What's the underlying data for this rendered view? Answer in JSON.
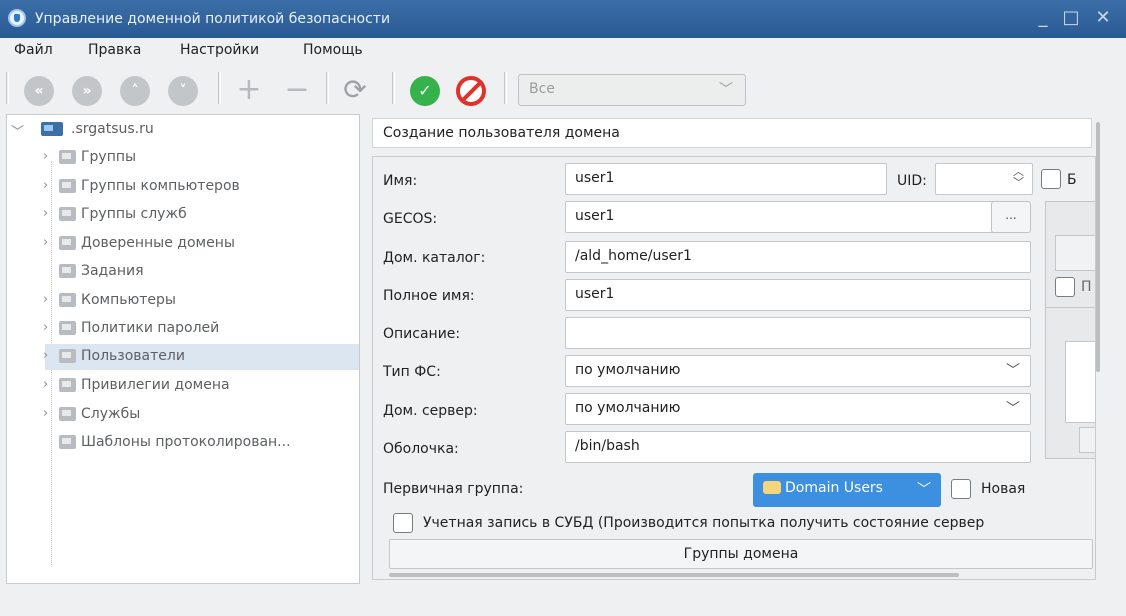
{
  "window": {
    "title": "Управление доменной политикой безопасности",
    "controls": [
      "_",
      "□",
      "✕"
    ]
  },
  "menu": [
    "Файл",
    "Правка",
    "Настройки",
    "Помощь"
  ],
  "toolbar": {
    "nav_buttons": [
      "«",
      "»",
      "˄",
      "˅"
    ],
    "add": "+",
    "remove": "−",
    "refresh": "⟳",
    "ok": "✓",
    "filter_value": "Все"
  },
  "tree": {
    "root": ".srgatsus.ru",
    "items": [
      {
        "label": "Группы",
        "expandable": true
      },
      {
        "label": "Группы компьютеров",
        "expandable": true
      },
      {
        "label": "Группы служб",
        "expandable": true
      },
      {
        "label": "Доверенные домены",
        "expandable": true
      },
      {
        "label": "Задания",
        "expandable": false
      },
      {
        "label": "Компьютеры",
        "expandable": true
      },
      {
        "label": "Политики паролей",
        "expandable": true
      },
      {
        "label": "Пользователи",
        "expandable": true,
        "selected": true
      },
      {
        "label": "Привилегии домена",
        "expandable": true
      },
      {
        "label": "Службы",
        "expandable": true
      },
      {
        "label": "Шаблоны протоколирован...",
        "expandable": false
      }
    ]
  },
  "form": {
    "section_title": "Создание пользователя домена",
    "name_label": "Имя:",
    "name_value": "user1",
    "uid_label": "UID:",
    "uid_value": "",
    "truncated_check_label": "Б",
    "gecos_label": "GECOS:",
    "gecos_value": "user1",
    "gecos_button": "...",
    "home_label": "Дом. каталог:",
    "home_value": "/ald_home/user1",
    "fullname_label": "Полное имя:",
    "fullname_value": "user1",
    "desc_label": "Описание:",
    "desc_value": "",
    "fstype_label": "Тип ФС:",
    "fstype_value": "по умолчанию",
    "homeserver_label": "Дом. сервер:",
    "homeserver_value": "по умолчанию",
    "shell_label": "Оболочка:",
    "shell_value": "/bin/bash",
    "primary_group_label": "Первичная группа:",
    "primary_group_value": "Domain Users",
    "new_label": "Новая",
    "dbms_label": "Учетная запись в СУБД  (Производится попытка получить состояние сервер",
    "groups_button": "Группы домена",
    "right_check_label": "П"
  }
}
